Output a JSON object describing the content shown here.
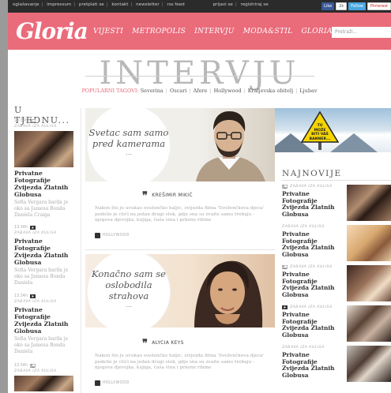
{
  "topbar": {
    "links": [
      "oglašavanje",
      "impressum",
      "pretplati se",
      "kontakt",
      "newsletter",
      "rss feed",
      "prijavi se",
      "registriraj se"
    ],
    "social": {
      "like": "Like",
      "count": "2k",
      "follow": "Follow",
      "pinterest": "Pinterest"
    }
  },
  "header": {
    "logo": "Gloria",
    "nav": [
      "VIJESTI",
      "METROPOLIS",
      "INTERVJU",
      "MODA&STIL",
      "GLORIAIN"
    ],
    "search_placeholder": "Pretraži..."
  },
  "page_title": "INTERVJU",
  "tags": {
    "label": "POPULARNI TAGOVI:",
    "items": [
      "Severina",
      "Oscari",
      "Afere",
      "Hollywood",
      "Kraljevska obitelj",
      "Ljubav"
    ]
  },
  "left": {
    "title": "U TJEDNU...",
    "cards": [
      {
        "time": "13:34h",
        "category": "ZABAVA IZA KULISA",
        "headline": "Privatne Fotografije Zvijezda Zlatnih Globusa",
        "excerpt": "Sofia Vergara barila je oko sa Jamesa Bonda Daniela Craiga"
      },
      {
        "time": "13:34h",
        "category": "ZABAVA IZA KULISA",
        "headline": "Privatne Fotografije Zvijezda Zlatnih Globusa",
        "excerpt": "Sofia Vergara barila je oko sa Jamesa Bonda Daniela"
      },
      {
        "time": "13:34h",
        "category": "ZABAVA IZA KULISA",
        "headline": "Privatne Fotografije Zvijezda Zlatnih Globusa",
        "excerpt": "Sofia Vergara barila je oko sa Jamesa Bonda Daniela"
      },
      {
        "time": "13:34h",
        "category": "ZABAVA IZA KULISA"
      }
    ]
  },
  "features": [
    {
      "quote_line1": "Svetac sam samo",
      "quote_line2": "pred kamerama",
      "dots": "...",
      "author": "KREŠIMIR MIKIĆ",
      "excerpt": "Nakon što je uvukao sveženčko haljic, zvijezda filma 'Sveženčkova djeca' podelio je ctići na jedan drugi stok, gdje sna su zvaite samo trebaju - njegova djevojka, kujiga, čaša vina i prkene ribine",
      "tag": "HOLLYWOOD"
    },
    {
      "quote_line1": "Konačno sam se",
      "quote_line2": "oslobodila",
      "quote_line3": "strahova",
      "dots": "...",
      "author": "ALYCIA KEYS",
      "excerpt": "Nakon što je uvukao sveženčko haljic, zvijezda filma 'Sveženčkova djeca' podelio je ctići na jedan drugi stok, gdje sna su zvaite samo trebaju - njegova djevojka, kujiga, čaša vina i prkene ribine",
      "tag": "HOLLYWOOD"
    }
  ],
  "banner": {
    "line1": "TU",
    "line2": "MOŽE",
    "line3": "BITI VAŠ",
    "line4": "BANNER..."
  },
  "right": {
    "title": "NAJNOVIJE",
    "cards": [
      {
        "category": "ZABAVA IZA KULISA",
        "headline": "Privatne Fotografije Zvijezda Zlatnih Globusa"
      },
      {
        "category": "ZABAVA IZA KULISA",
        "headline": "Privatne Fotografije Zvijezda Zlatnih Globusa"
      },
      {
        "category": "ZABAVA IZA KULISA",
        "headline": "Privatne Fotografije Zvijezda Zlatnih Globusa"
      },
      {
        "category": "ZABAVA IZA KULISA",
        "headline": "Privatne Fotografije Zvijezda Zlatnih Globusa"
      },
      {
        "category": "ZABAVA IZA KULISA",
        "headline": "Privatne Fotografije Zvijezda Zlatnih Globusa"
      }
    ]
  }
}
